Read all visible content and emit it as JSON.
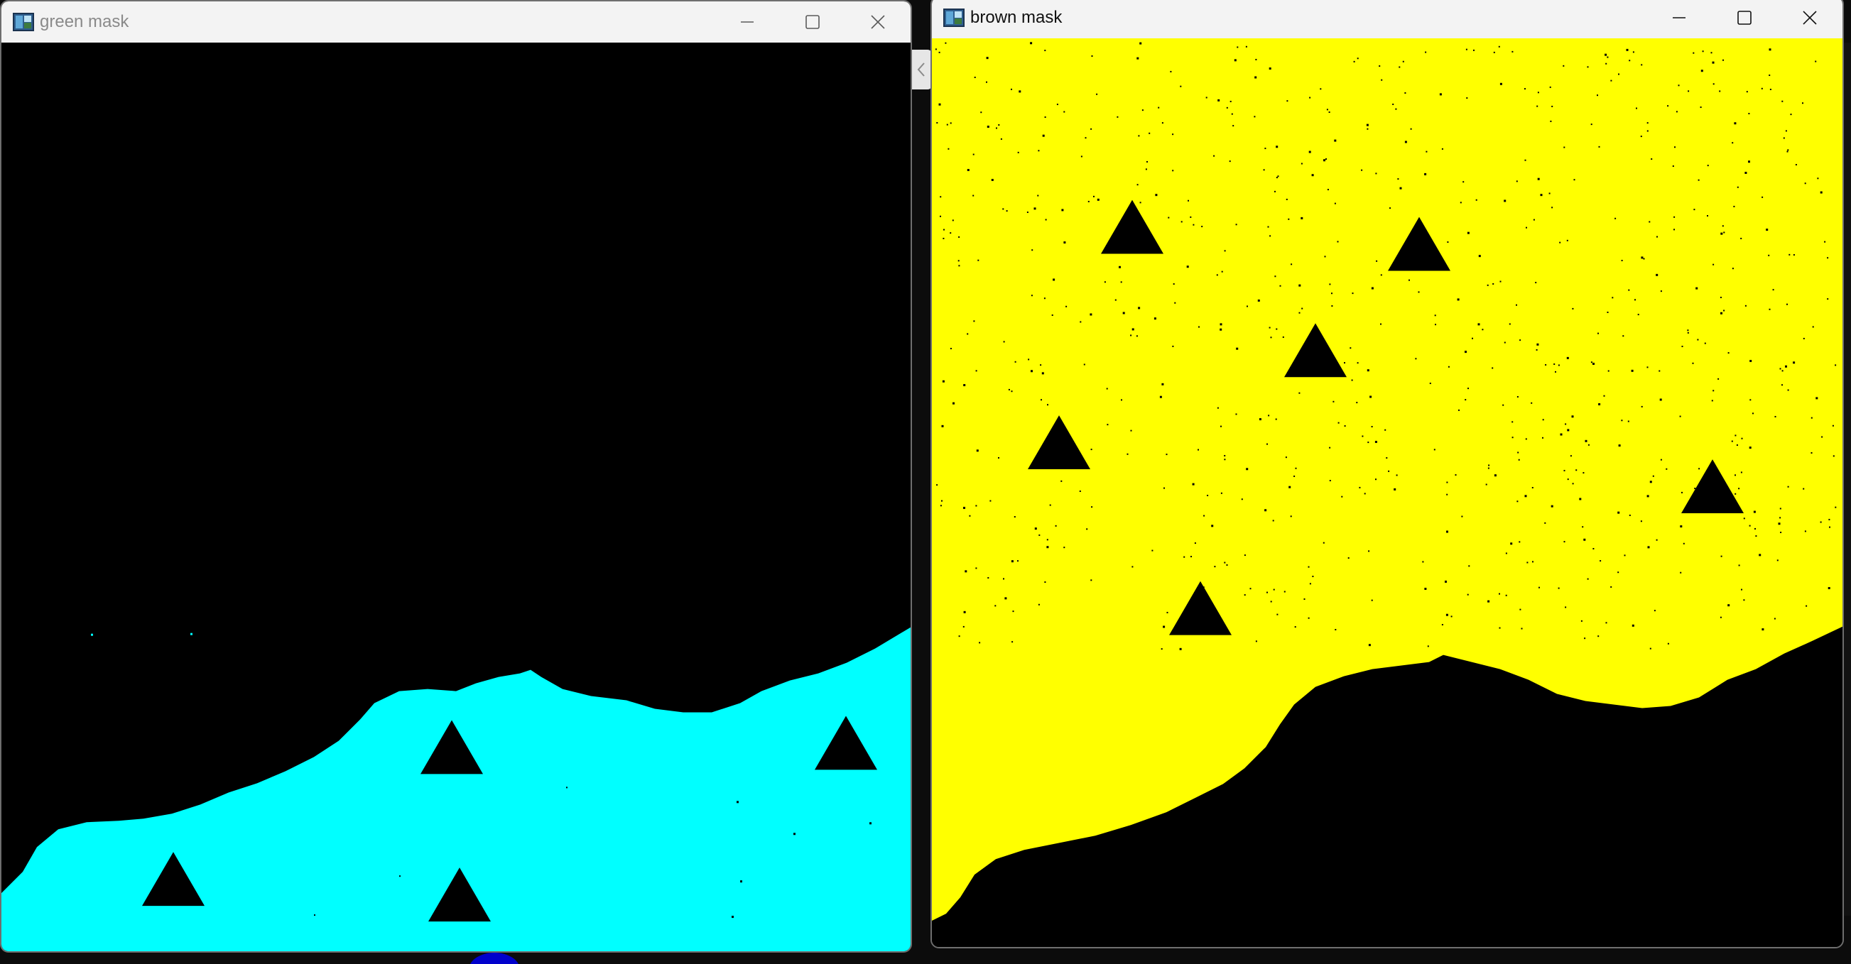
{
  "windows": [
    {
      "title": "green mask",
      "active": false,
      "mask_color": "#00ffff",
      "background_color": "#000000",
      "controls": [
        "minimize-icon",
        "maximize-icon",
        "close-icon"
      ]
    },
    {
      "title": "brown mask",
      "active": true,
      "mask_color": "#ffff00",
      "background_color": "#000000",
      "controls": [
        "minimize-icon",
        "maximize-icon",
        "close-icon"
      ]
    }
  ],
  "colors": {
    "titlebar": "#f3f3f3",
    "window_border": "#6e6e6e",
    "markers": "#000000",
    "taskbar_accent": "#0000cc"
  }
}
